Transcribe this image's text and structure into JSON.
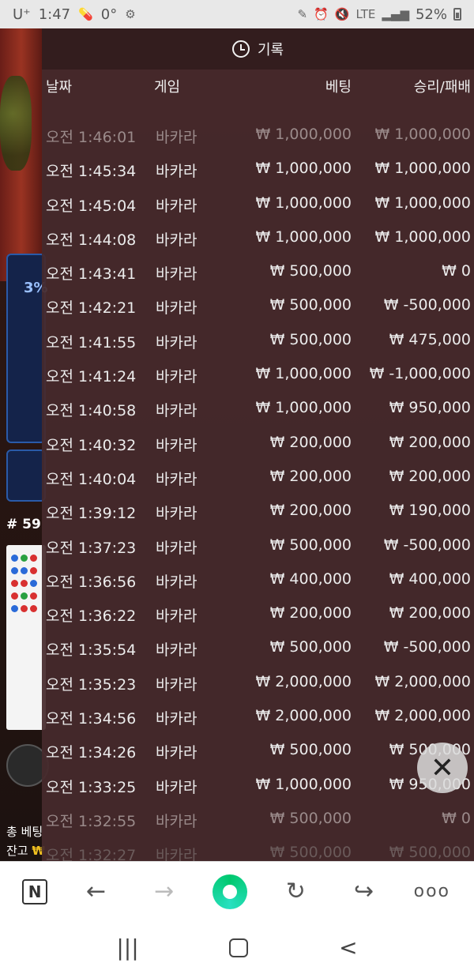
{
  "status_bar": {
    "carrier": "U⁺",
    "time": "1:47",
    "temp": "0°",
    "network": "LTE",
    "battery": "52%"
  },
  "game": {
    "side_percent": "3%",
    "round_label": "# 59",
    "total_bet_label": "총 베팅",
    "balance_label": "잔고",
    "balance_currency": "₩"
  },
  "history": {
    "title": "기록",
    "columns": {
      "date": "날짜",
      "game": "게임",
      "bet": "베팅",
      "result": "승리/패배"
    },
    "rows": [
      {
        "date": "오전 1:46:01",
        "game": "바카라",
        "bet": "₩ 1,000,000",
        "result": "₩ 1,000,000"
      },
      {
        "date": "오전 1:45:34",
        "game": "바카라",
        "bet": "₩ 1,000,000",
        "result": "₩ 1,000,000"
      },
      {
        "date": "오전 1:45:04",
        "game": "바카라",
        "bet": "₩ 1,000,000",
        "result": "₩ 1,000,000"
      },
      {
        "date": "오전 1:44:08",
        "game": "바카라",
        "bet": "₩ 1,000,000",
        "result": "₩ 1,000,000"
      },
      {
        "date": "오전 1:43:41",
        "game": "바카라",
        "bet": "₩ 500,000",
        "result": "₩ 0"
      },
      {
        "date": "오전 1:42:21",
        "game": "바카라",
        "bet": "₩ 500,000",
        "result": "₩ -500,000"
      },
      {
        "date": "오전 1:41:55",
        "game": "바카라",
        "bet": "₩ 500,000",
        "result": "₩ 475,000"
      },
      {
        "date": "오전 1:41:24",
        "game": "바카라",
        "bet": "₩ 1,000,000",
        "result": "₩ -1,000,000"
      },
      {
        "date": "오전 1:40:58",
        "game": "바카라",
        "bet": "₩ 1,000,000",
        "result": "₩ 950,000"
      },
      {
        "date": "오전 1:40:32",
        "game": "바카라",
        "bet": "₩ 200,000",
        "result": "₩ 200,000"
      },
      {
        "date": "오전 1:40:04",
        "game": "바카라",
        "bet": "₩ 200,000",
        "result": "₩ 200,000"
      },
      {
        "date": "오전 1:39:12",
        "game": "바카라",
        "bet": "₩ 200,000",
        "result": "₩ 190,000"
      },
      {
        "date": "오전 1:37:23",
        "game": "바카라",
        "bet": "₩ 500,000",
        "result": "₩ -500,000"
      },
      {
        "date": "오전 1:36:56",
        "game": "바카라",
        "bet": "₩ 400,000",
        "result": "₩ 400,000"
      },
      {
        "date": "오전 1:36:22",
        "game": "바카라",
        "bet": "₩ 200,000",
        "result": "₩ 200,000"
      },
      {
        "date": "오전 1:35:54",
        "game": "바카라",
        "bet": "₩ 500,000",
        "result": "₩ -500,000"
      },
      {
        "date": "오전 1:35:23",
        "game": "바카라",
        "bet": "₩ 2,000,000",
        "result": "₩ 2,000,000"
      },
      {
        "date": "오전 1:34:56",
        "game": "바카라",
        "bet": "₩ 2,000,000",
        "result": "₩ 2,000,000"
      },
      {
        "date": "오전 1:34:26",
        "game": "바카라",
        "bet": "₩ 500,000",
        "result": "₩ 500,000"
      },
      {
        "date": "오전 1:33:25",
        "game": "바카라",
        "bet": "₩ 1,000,000",
        "result": "₩ 950,000"
      },
      {
        "date": "오전 1:32:55",
        "game": "바카라",
        "bet": "₩ 500,000",
        "result": "₩ 0"
      },
      {
        "date": "오전 1:32:27",
        "game": "바카라",
        "bet": "₩ 500,000",
        "result": "₩ 500,000"
      }
    ]
  },
  "browser_toolbar": {
    "logo": "N",
    "back": "←",
    "forward": "→",
    "reload": "↻",
    "share": "↪",
    "more": "ooo"
  },
  "system_nav": {
    "recents": "|||",
    "back": "<"
  }
}
